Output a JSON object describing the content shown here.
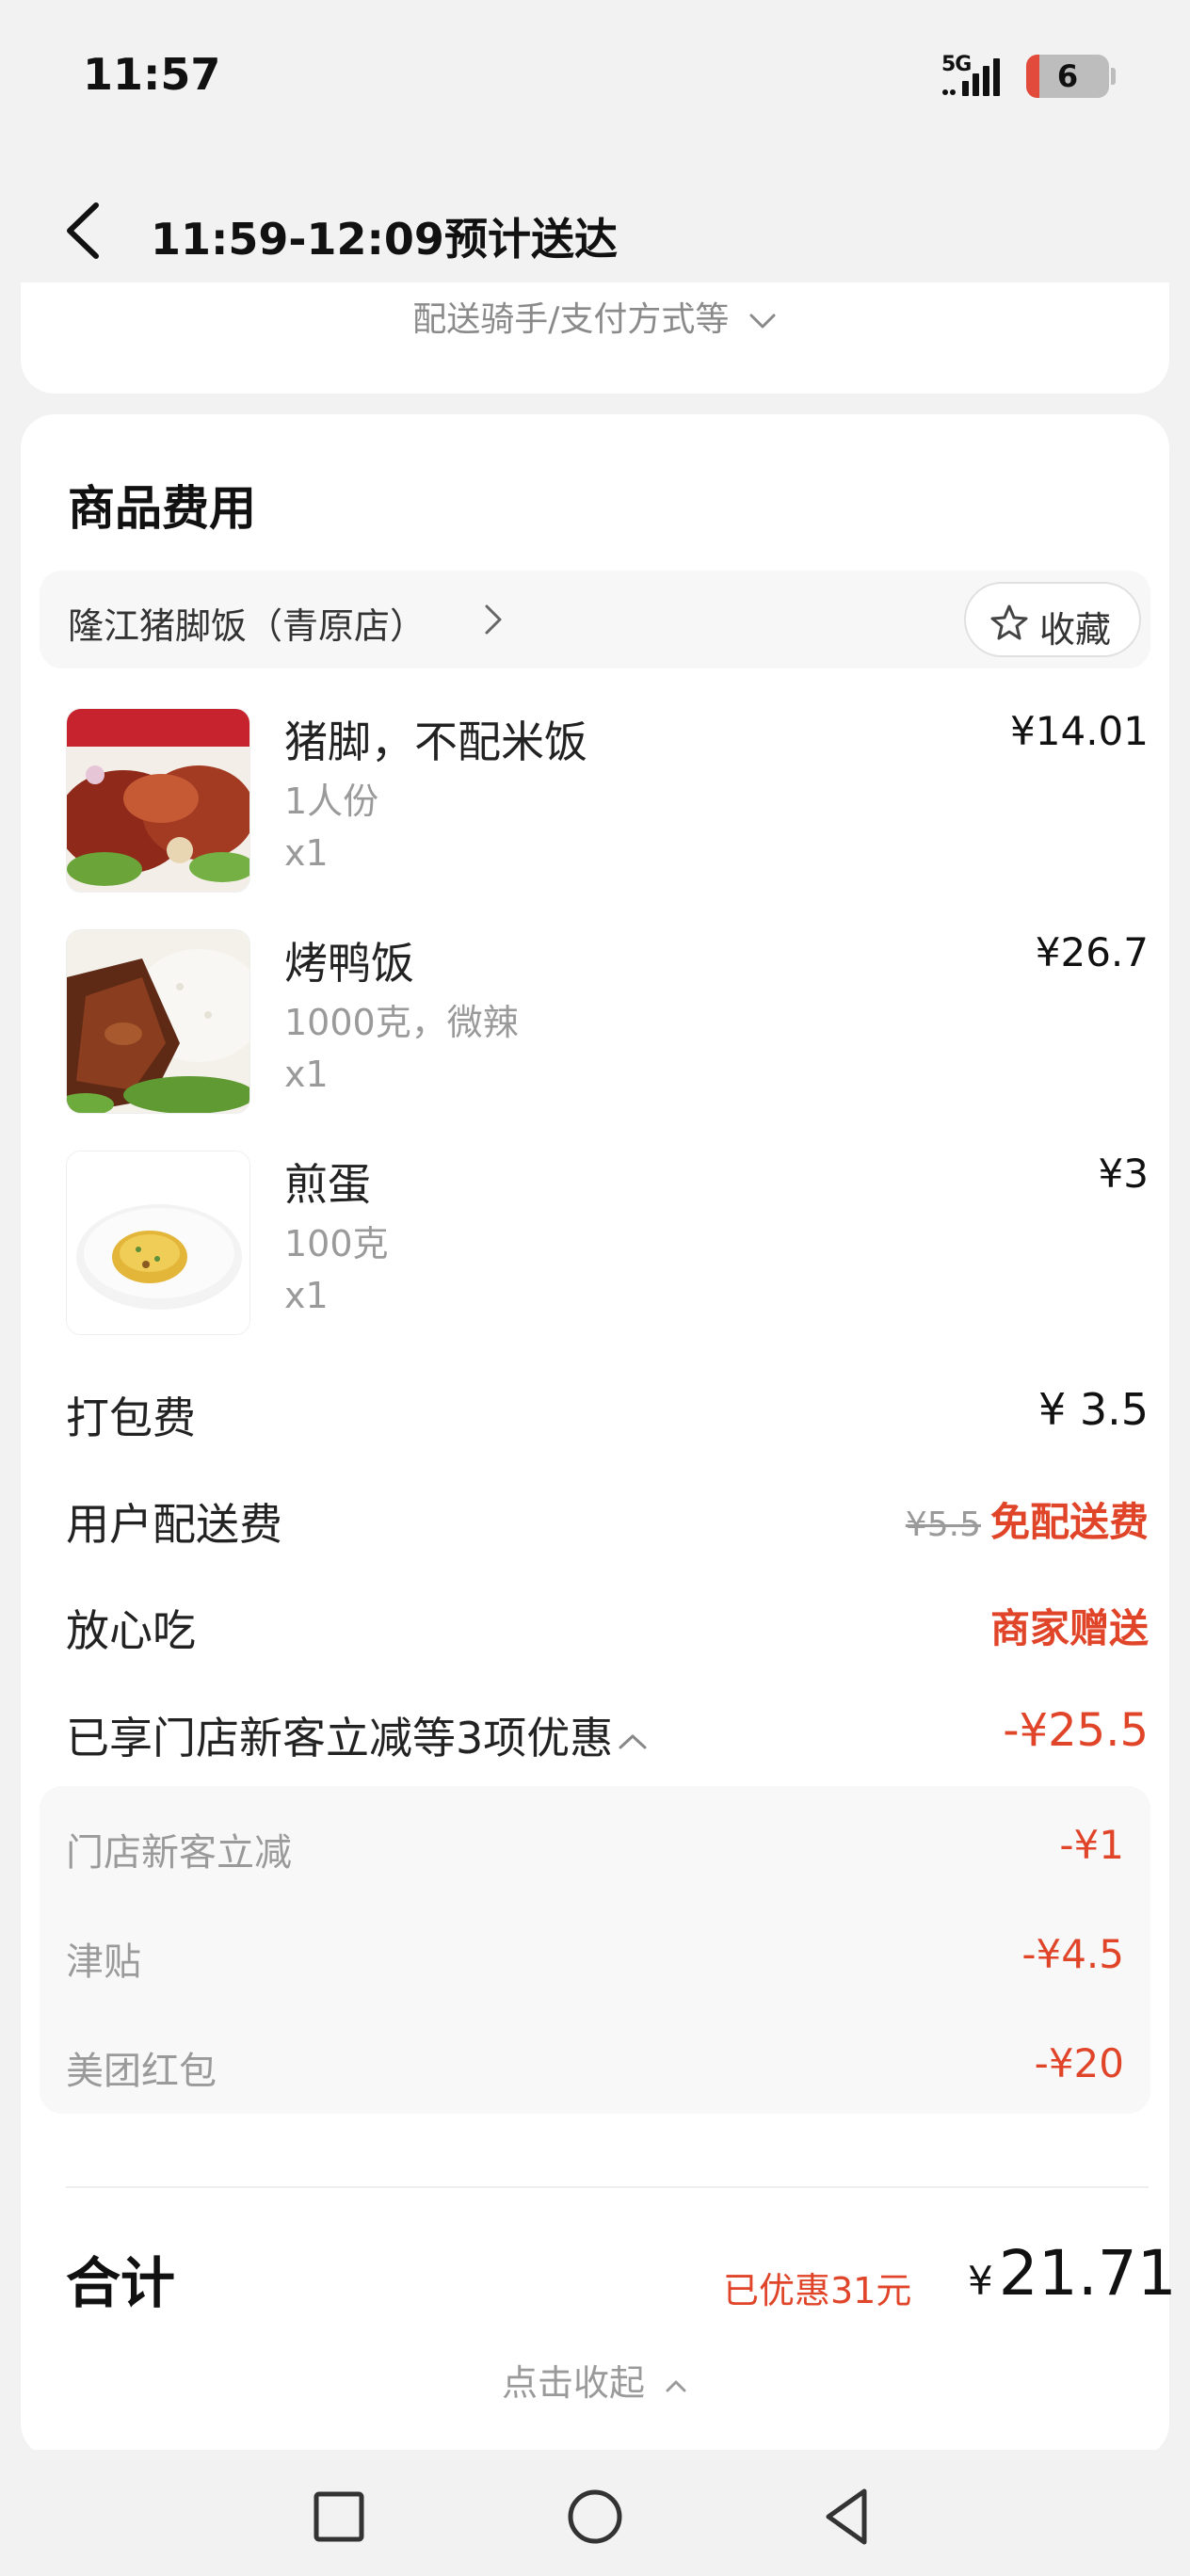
{
  "status_bar": {
    "time": "11:57",
    "network": "5G",
    "battery": "6"
  },
  "header": {
    "title": "11:59-12:09预计送达",
    "back_icon": "chevron-left-icon"
  },
  "delivery": {
    "toggle_label": "配送骑手/支付方式等"
  },
  "order": {
    "section_title": "商品费用",
    "store_name": "隆江猪脚饭（青原店）",
    "favorite_label": "收藏",
    "items": [
      {
        "name": "猪脚，不配米饭",
        "spec": "1人份",
        "qty": "x1",
        "price": "¥14.01"
      },
      {
        "name": "烤鸭饭",
        "spec": "1000克，微辣",
        "qty": "x1",
        "price": "¥26.7"
      },
      {
        "name": "煎蛋",
        "spec": "100克",
        "qty": "x1",
        "price": "¥3"
      }
    ],
    "fees": {
      "packing_label": "打包费",
      "packing_value": "¥ 3.5",
      "delivery_label": "用户配送费",
      "delivery_original": "¥5.5",
      "delivery_value": "免配送费",
      "worry_free_label": "放心吃",
      "worry_free_value": "商家赠送"
    },
    "discounts": {
      "summary_label": "已享门店新客立减等3项优惠",
      "summary_value": "-¥25.5",
      "rows": [
        {
          "label": "门店新客立减",
          "value": "-¥1"
        },
        {
          "label": "津贴",
          "value": "-¥4.5"
        },
        {
          "label": "美团红包",
          "value": "-¥20"
        }
      ]
    },
    "total": {
      "label": "合计",
      "saved": "已优惠31元",
      "currency": "¥",
      "amount": "21.71"
    },
    "collapse_label": "点击收起"
  },
  "colors": {
    "accent": "#e0452a",
    "background": "#f2f2f2",
    "card": "#ffffff"
  }
}
